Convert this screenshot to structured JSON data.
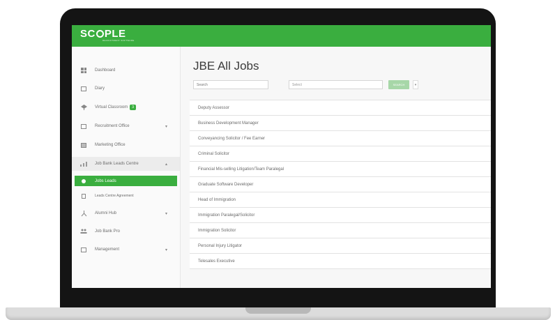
{
  "app": {
    "logo": "SC",
    "logo_rest": "PLE",
    "logo_sub": "RECRUITMENT SOFTWARE"
  },
  "sidebar": {
    "items": [
      {
        "label": "Dashboard",
        "icon": "dashboard-icon"
      },
      {
        "label": "Diary",
        "icon": "calendar-icon"
      },
      {
        "label": "Virtual Classroom",
        "icon": "classroom-icon",
        "badge": "3"
      },
      {
        "label": "Recruitment Office",
        "icon": "office-icon",
        "chevron": "▾"
      },
      {
        "label": "Marketing Office",
        "icon": "marketing-icon"
      },
      {
        "label": "Job Bank Leads Centre",
        "icon": "leads-icon",
        "chevron": "▴"
      },
      {
        "label": "Jobs Leads",
        "icon": "dot-icon"
      },
      {
        "label": "Leads Centre Agreement",
        "icon": "document-icon"
      },
      {
        "label": "Alumni Hub",
        "icon": "network-icon",
        "chevron": "▾"
      },
      {
        "label": "Job Bank Pro",
        "icon": "group-icon"
      },
      {
        "label": "Management",
        "icon": "management-icon",
        "chevron": "▾"
      }
    ]
  },
  "main": {
    "title": "JBE All Jobs",
    "search_placeholder": "Search",
    "select_placeholder": "Select",
    "search_button": "SEARCH",
    "caret": "▾",
    "jobs": [
      "Deputy Assessor",
      "Business Development Manager",
      "Conveyancing Solicitor / Fee Earner",
      "Criminal Solicitor",
      "Financial Mis-selling Litigation/Team Paralegal",
      "Graduate Software Developer",
      "Head of Immigration",
      "Immigration Paralegal/Solicitor",
      "Immigration Solicitor",
      "Personal Injury Litigator",
      "Telesales Executive"
    ]
  },
  "colors": {
    "accent": "#3aae3f",
    "frame": "#141414"
  }
}
